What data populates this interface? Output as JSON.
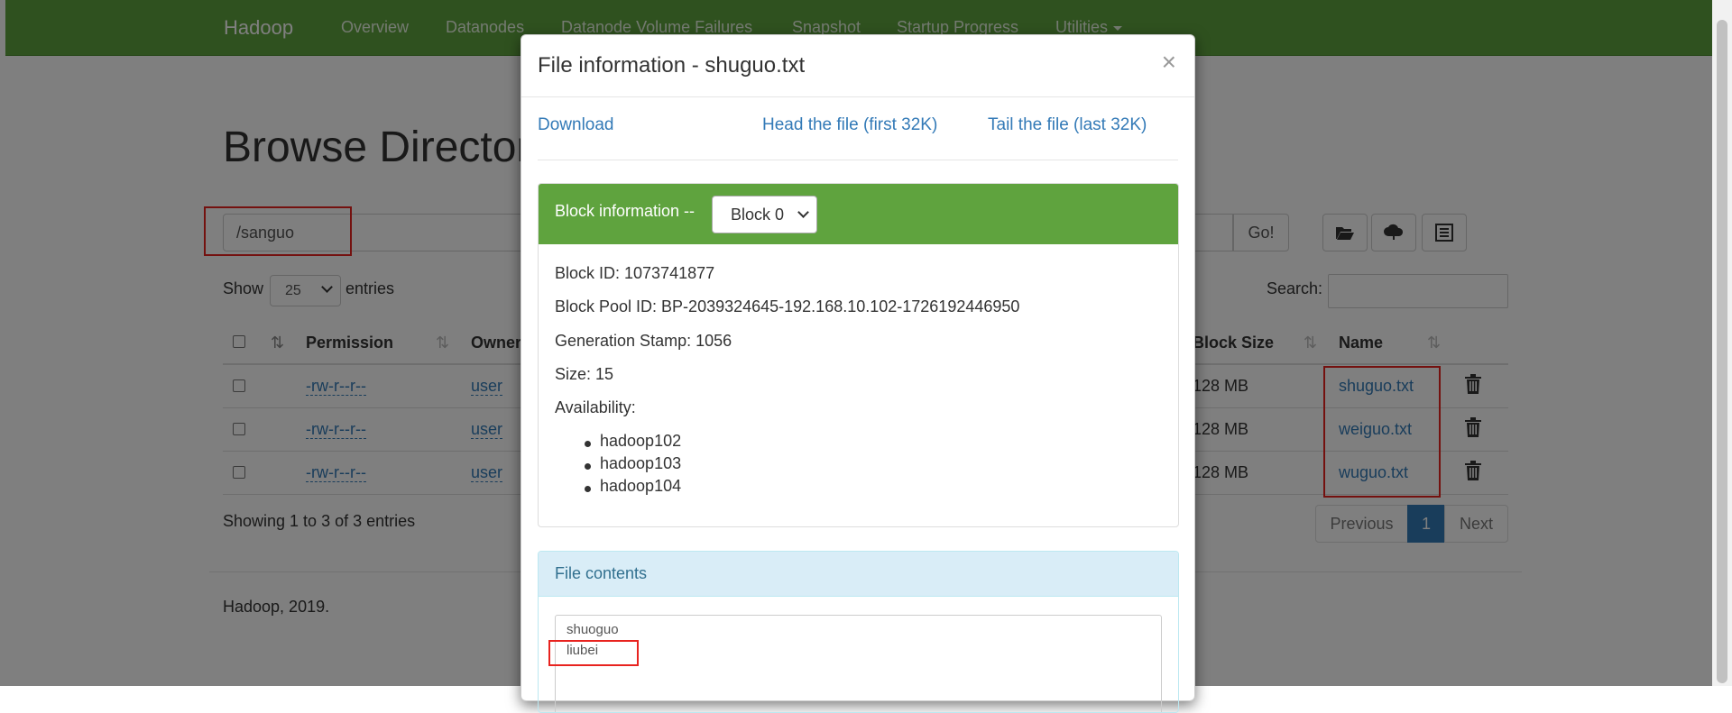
{
  "navbar": {
    "brand": "Hadoop",
    "items": [
      "Overview",
      "Datanodes",
      "Datanode Volume Failures",
      "Snapshot",
      "Startup Progress",
      "Utilities"
    ]
  },
  "page": {
    "title": "Browse Directory",
    "path": "/sanguo",
    "go_label": "Go!",
    "show_label": "Show",
    "entries_value": "25",
    "entries_label": "entries",
    "search_label": "Search:",
    "columns": [
      "Permission",
      "Owner",
      "Block Size",
      "Name"
    ],
    "rows": [
      {
        "permission": "-rw-r--r--",
        "owner": "user",
        "block_size": "128 MB",
        "name": "shuguo.txt"
      },
      {
        "permission": "-rw-r--r--",
        "owner": "user",
        "block_size": "128 MB",
        "name": "weiguo.txt"
      },
      {
        "permission": "-rw-r--r--",
        "owner": "user",
        "block_size": "128 MB",
        "name": "wuguo.txt"
      }
    ],
    "showing": "Showing 1 to 3 of 3 entries",
    "pager": {
      "previous": "Previous",
      "current": "1",
      "next": "Next"
    },
    "footer": "Hadoop, 2019."
  },
  "modal": {
    "title": "File information - shuguo.txt",
    "close": "×",
    "links": {
      "download": "Download",
      "head": "Head the file (first 32K)",
      "tail": "Tail the file (last 32K)"
    },
    "block_info_label": "Block information --",
    "block_select": "Block 0",
    "block_id": "Block ID: 1073741877",
    "block_pool_id": "Block Pool ID: BP-2039324645-192.168.10.102-1726192446950",
    "generation_stamp": "Generation Stamp: 1056",
    "size": "Size: 15",
    "availability_label": "Availability:",
    "hosts": [
      "hadoop102",
      "hadoop103",
      "hadoop104"
    ],
    "file_contents_label": "File contents",
    "file_lines": [
      "shuoguo",
      "liubei"
    ]
  },
  "colors": {
    "navbar": "#5fa33e",
    "link": "#337ab7",
    "annotation": "#e8231f",
    "pager_active": "#337ab7"
  }
}
